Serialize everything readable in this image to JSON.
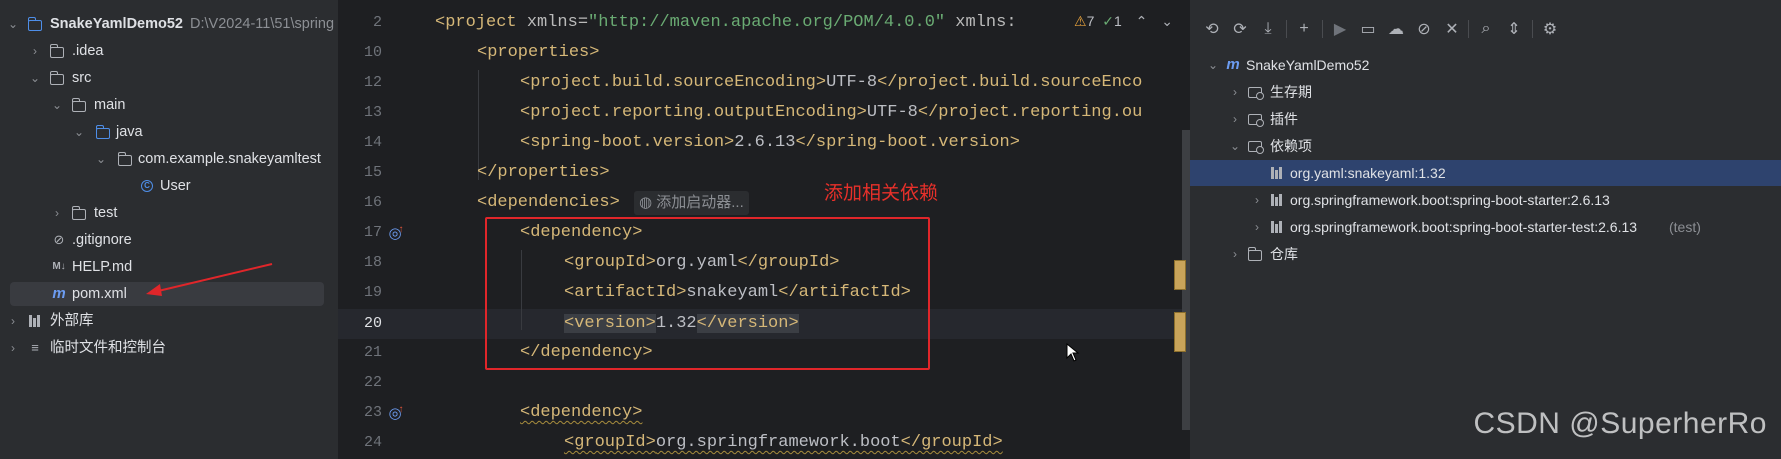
{
  "project_tree": {
    "root": {
      "label": "SnakeYamlDemo52",
      "path": "D:\\V2024-11\\51\\spring"
    },
    "items": [
      {
        "label": ".idea"
      },
      {
        "label": "src"
      },
      {
        "label": "main"
      },
      {
        "label": "java"
      },
      {
        "label": "com.example.snakeyamltest"
      },
      {
        "label": "User"
      },
      {
        "label": "test"
      },
      {
        "label": ".gitignore"
      },
      {
        "label": "HELP.md"
      },
      {
        "label": "pom.xml"
      },
      {
        "label": "外部库"
      },
      {
        "label": "临时文件和控制台"
      }
    ]
  },
  "editor": {
    "line_numbers": [
      "2",
      "10",
      "12",
      "13",
      "14",
      "15",
      "16",
      "17",
      "18",
      "19",
      "20",
      "21",
      "22",
      "23",
      "24"
    ],
    "lines": [
      {
        "open": "<project",
        "attr": " xmlns=",
        "str": "\"http://maven.apache.org/POM/4.0.0\"",
        "rest": " xmlns:"
      },
      {
        "open": "<properties>"
      },
      {
        "open": "<project.build.sourceEncoding>",
        "text": "UTF-8",
        "close": "</project.build.sourceEnco"
      },
      {
        "open": "<project.reporting.outputEncoding>",
        "text": "UTF-8",
        "close": "</project.reporting.ou"
      },
      {
        "open": "<spring-boot.version>",
        "text": "2.6.13",
        "close": "</spring-boot.version>"
      },
      {
        "open": "</properties>"
      },
      {
        "open": "<dependencies>"
      },
      {
        "open": "<dependency>"
      },
      {
        "open": "<groupId>",
        "text": "org.yaml",
        "close": "</groupId>"
      },
      {
        "open": "<artifactId>",
        "text": "snakeyaml",
        "close": "</artifactId>"
      },
      {
        "open": "<version>",
        "text": "1.32",
        "close": "</version>"
      },
      {
        "open": "</dependency>"
      },
      {
        "open": ""
      },
      {
        "open": "<dependency>"
      },
      {
        "open": "<groupId>",
        "text": "org.springframework.boot",
        "close": "</groupId>"
      }
    ],
    "hint": "添加启动器...",
    "inspections": {
      "warnings": "7",
      "weak": "1"
    },
    "annotation": "添加相关依赖"
  },
  "maven": {
    "root": "SnakeYamlDemo52",
    "items": [
      {
        "label": "生存期"
      },
      {
        "label": "插件"
      },
      {
        "label": "依赖项"
      },
      {
        "label": "org.yaml:snakeyaml:1.32"
      },
      {
        "label": "org.springframework.boot:spring-boot-starter:2.6.13"
      },
      {
        "label": "org.springframework.boot:spring-boot-starter-test:2.6.13",
        "extra": "(test)"
      },
      {
        "label": "仓库"
      }
    ]
  },
  "watermark": "CSDN @SuperherRo",
  "colors": {
    "annotation_red": "#e0262a",
    "selection": "#2e436e",
    "tag": "#d5b778"
  }
}
